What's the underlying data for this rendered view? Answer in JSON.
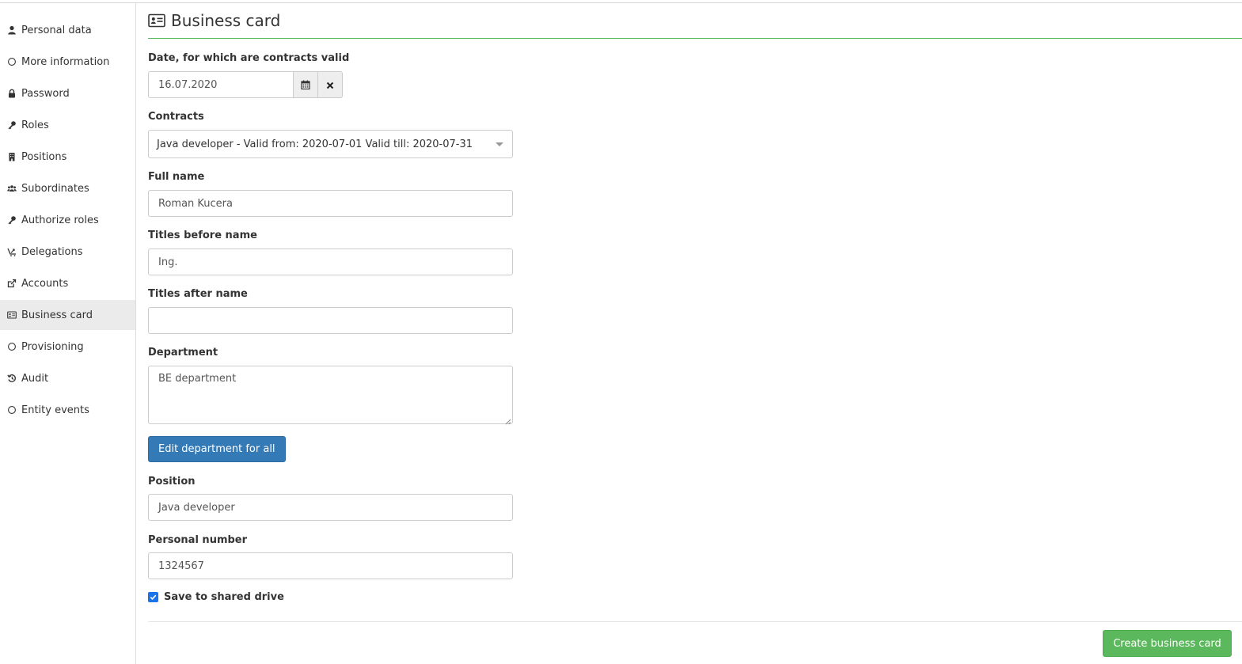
{
  "colors": {
    "accent_blue": "#337ab7",
    "accent_green": "#5cb85c",
    "checkbox": "#1a73e8",
    "active_bg": "#ebebeb"
  },
  "sidebar": {
    "items": [
      {
        "label": "Personal data",
        "icon": "user-icon"
      },
      {
        "label": "More information",
        "icon": "circle-icon"
      },
      {
        "label": "Password",
        "icon": "lock-icon"
      },
      {
        "label": "Roles",
        "icon": "key-icon"
      },
      {
        "label": "Positions",
        "icon": "building-icon"
      },
      {
        "label": "Subordinates",
        "icon": "users-icon"
      },
      {
        "label": "Authorize roles",
        "icon": "key-icon"
      },
      {
        "label": "Delegations",
        "icon": "delegation-icon"
      },
      {
        "label": "Accounts",
        "icon": "external-link-icon"
      },
      {
        "label": "Business card",
        "icon": "id-card-icon",
        "active": true
      },
      {
        "label": "Provisioning",
        "icon": "circle-icon"
      },
      {
        "label": "Audit",
        "icon": "history-icon"
      },
      {
        "label": "Entity events",
        "icon": "circle-icon"
      }
    ]
  },
  "page": {
    "title": "Business card",
    "title_icon": "id-card-icon"
  },
  "form": {
    "date": {
      "label": "Date, for which are contracts valid",
      "value": "16.07.2020"
    },
    "contracts": {
      "label": "Contracts",
      "value": "Java developer - Valid from: 2020-07-01 Valid till: 2020-07-31"
    },
    "full_name": {
      "label": "Full name",
      "value": "Roman Kucera"
    },
    "titles_before": {
      "label": "Titles before name",
      "value": "Ing."
    },
    "titles_after": {
      "label": "Titles after name",
      "value": ""
    },
    "department": {
      "label": "Department",
      "value": "BE department"
    },
    "edit_department_button": "Edit department for all",
    "position": {
      "label": "Position",
      "value": "Java developer"
    },
    "personal_number": {
      "label": "Personal number",
      "value": "1324567"
    },
    "save_shared": {
      "label": "Save to shared drive",
      "checked": true
    }
  },
  "actions": {
    "create_button": "Create business card"
  }
}
